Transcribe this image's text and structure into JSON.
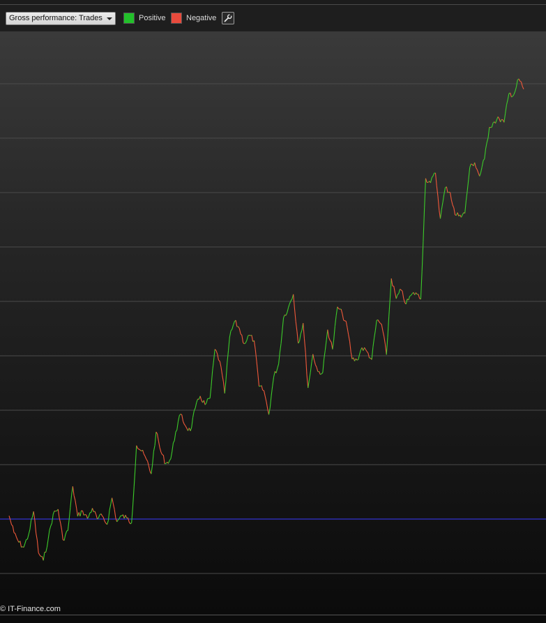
{
  "toolbar": {
    "dropdown_label": "Gross performance: Trades",
    "legend": [
      {
        "label": "Positive",
        "color": "#22c02a"
      },
      {
        "label": "Negative",
        "color": "#e84a3c"
      }
    ],
    "settings_icon": "wrench-icon"
  },
  "footer": {
    "copyright": "© IT-Finance.com"
  },
  "colors": {
    "positive": "#3ccc2a",
    "negative": "#f0583a",
    "baseline": "#3a3aff",
    "grid": "#4a4a4a"
  },
  "chart_data": {
    "type": "line",
    "title": "",
    "xlabel": "",
    "ylabel": "",
    "grid": true,
    "gridline_count": 10,
    "baseline": 0,
    "ylim": [
      -1,
      8
    ],
    "note": "Unlabeled cumulative gross performance per trade; values relative to baseline (one grid step = 1 unit).",
    "series": [
      {
        "values": [
          0.06,
          -0.25,
          -0.43,
          -0.52,
          -0.28,
          0.14,
          -0.62,
          -0.76,
          -0.36,
          0.09,
          0.18,
          -0.38,
          -0.21,
          0.6,
          0.05,
          0.15,
          0.01,
          0.2,
          0.0,
          0.06,
          -0.1,
          0.39,
          -0.05,
          0.06,
          0.02,
          -0.07,
          1.35,
          1.25,
          1.1,
          0.83,
          1.6,
          1.23,
          1.02,
          1.11,
          1.6,
          1.93,
          1.71,
          1.62,
          2.04,
          2.26,
          2.1,
          2.22,
          3.12,
          2.9,
          2.31,
          3.34,
          3.63,
          3.5,
          3.22,
          3.38,
          3.28,
          2.44,
          2.36,
          1.92,
          2.61,
          2.85,
          3.7,
          3.89,
          4.13,
          3.23,
          3.6,
          2.41,
          3.03,
          2.71,
          2.69,
          3.48,
          3.12,
          3.9,
          3.77,
          3.52,
          2.94,
          2.92,
          3.15,
          3.08,
          2.93,
          3.65,
          3.58,
          3.02,
          4.42,
          4.05,
          4.21,
          3.95,
          4.11,
          4.16,
          4.04,
          6.26,
          6.18,
          6.36,
          5.52,
          6.09,
          6.0,
          5.59,
          5.59,
          5.62,
          6.46,
          6.55,
          6.3,
          6.62,
          7.2,
          7.3,
          7.36,
          7.29,
          7.82,
          7.8,
          8.09,
          7.9
        ]
      }
    ]
  }
}
